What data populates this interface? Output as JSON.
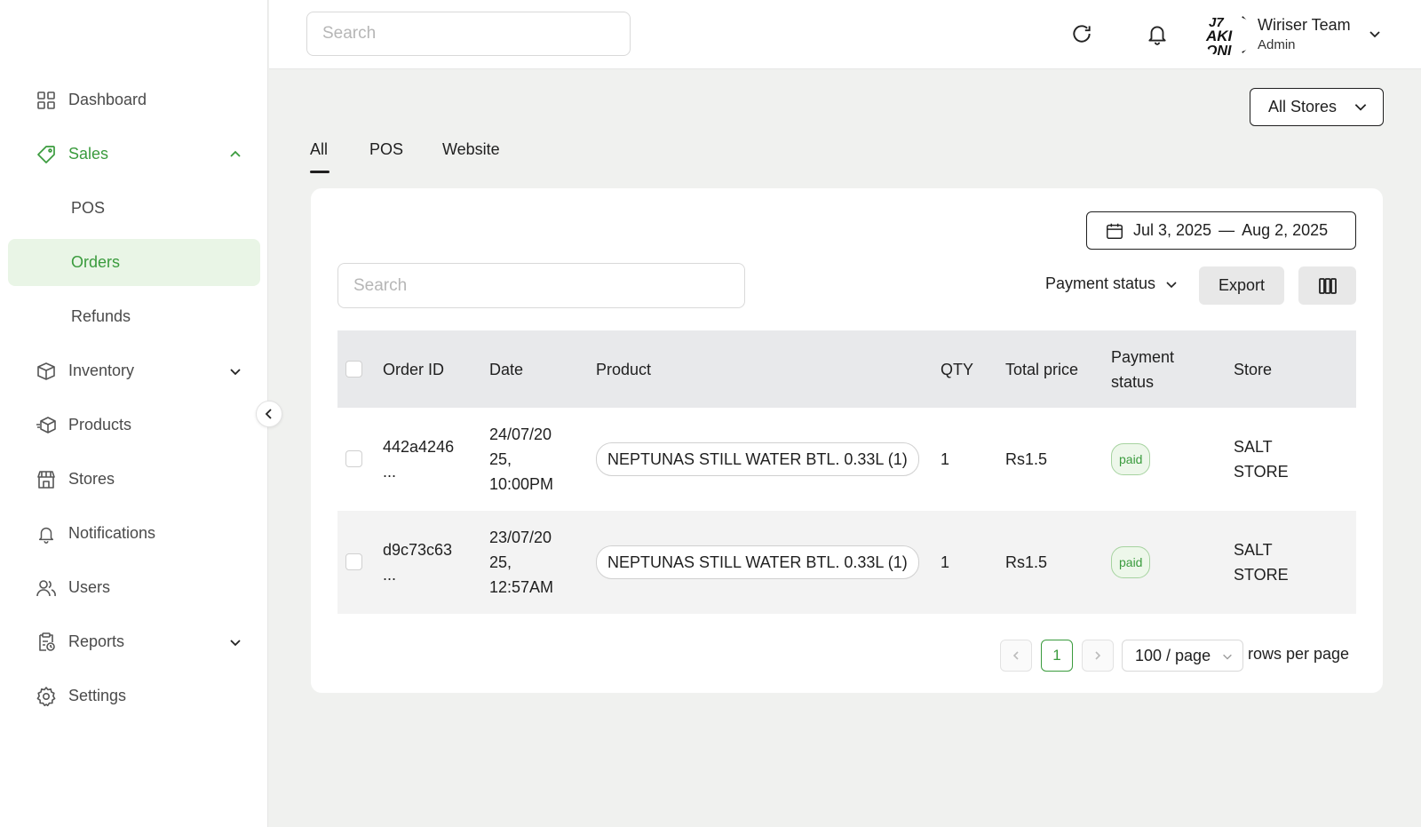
{
  "header": {
    "search_placeholder": "Search",
    "user_name": "Wiriser Team",
    "user_role": "Admin",
    "icons": [
      "refresh-icon",
      "bell-icon",
      "chevron-down-icon"
    ]
  },
  "sidebar": {
    "items": [
      {
        "label": "Dashboard",
        "icon": "grid-icon"
      },
      {
        "label": "Sales",
        "icon": "tag-icon"
      },
      {
        "label": "Inventory",
        "icon": "box-icon"
      },
      {
        "label": "Products",
        "icon": "package-icon"
      },
      {
        "label": "Stores",
        "icon": "store-icon"
      },
      {
        "label": "Notifications",
        "icon": "bell-icon"
      },
      {
        "label": "Users",
        "icon": "users-icon"
      },
      {
        "label": "Reports",
        "icon": "report-icon"
      },
      {
        "label": "Settings",
        "icon": "gear-icon"
      }
    ],
    "sales_sub": [
      {
        "label": "POS"
      },
      {
        "label": "Orders"
      },
      {
        "label": "Refunds"
      }
    ],
    "active": "Orders"
  },
  "store_filter": {
    "selected": "All Stores"
  },
  "tabs": [
    {
      "label": "All",
      "active": true
    },
    {
      "label": "POS"
    },
    {
      "label": "Website"
    }
  ],
  "card": {
    "date_start": "Jul 3, 2025",
    "date_sep": "—",
    "date_end": "Aug 2, 2025",
    "search_placeholder": "Search",
    "payment_filter": "Payment status",
    "export_label": "Export"
  },
  "table": {
    "headers": {
      "order_id": "Order ID",
      "date": "Date",
      "product": "Product",
      "qty": "QTY",
      "total": "Total price",
      "payment_line1": "Payment",
      "payment_line2": "status",
      "store": "Store"
    },
    "rows": [
      {
        "order_id_1": "442a4246",
        "order_id_2": "...",
        "date_1": "24/07/20",
        "date_2": "25,",
        "date_3": "10:00PM",
        "product": "NEPTUNAS STILL WATER BTL. 0.33L (1)",
        "qty": "1",
        "total": "Rs1.5",
        "payment": "paid",
        "store_1": "SALT",
        "store_2": "STORE"
      },
      {
        "order_id_1": "d9c73c63",
        "order_id_2": "...",
        "date_1": "23/07/20",
        "date_2": "25,",
        "date_3": "12:57AM",
        "product": "NEPTUNAS STILL WATER BTL. 0.33L (1)",
        "qty": "1",
        "total": "Rs1.5",
        "payment": "paid",
        "store_1": "SALT",
        "store_2": "STORE"
      }
    ]
  },
  "pagination": {
    "current_page": "1",
    "per_page": "100 / page",
    "rows_label": "rows per page"
  },
  "colors": {
    "accent": "#3a9b3d",
    "active_bg": "#e9f5e6",
    "page_bg": "#f0f1ef"
  }
}
